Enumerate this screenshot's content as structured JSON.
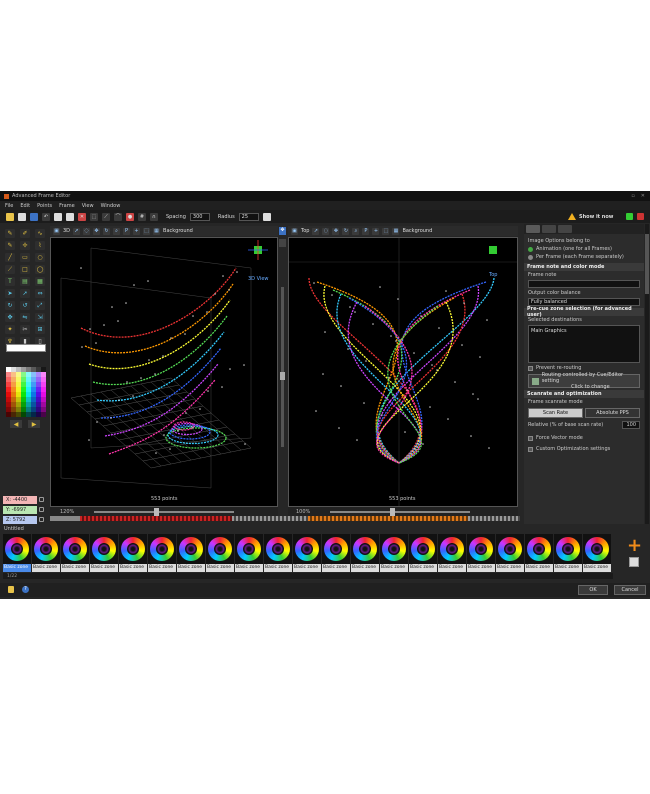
{
  "window": {
    "title": "Advanced Frame Editor"
  },
  "menu": [
    "File",
    "Edit",
    "Points",
    "Frame",
    "View",
    "Window"
  ],
  "toolbar": {
    "spacing_label": "Spacing",
    "spacing_value": "300",
    "radius_label": "Radius",
    "radius_value": "25",
    "show_label": "Show it now"
  },
  "coords": {
    "x": "X: -4400",
    "y": "Y: -6997",
    "z": "Z: 5792"
  },
  "viewport_left": {
    "mode": "3D",
    "background_label": "Background",
    "view_tag": "3D View",
    "points": "553 points",
    "zoom": "120%"
  },
  "viewport_right": {
    "mode": "Top",
    "background_label": "Background",
    "view_tag": "Top",
    "points": "553 points",
    "zoom": "100%"
  },
  "panel": {
    "options_title": "Image Options belong to",
    "opt_animation": "Animation (one for all Frames)",
    "opt_perframe": "Per Frame (each Frame separately)",
    "sec_note": "Frame note and color mode",
    "frame_note_label": "Frame note",
    "output_color_label": "Output color balance",
    "output_color_value": "Fully balanced",
    "sec_zone": "Pre-cue zone selection (for advanced user)",
    "dest_label": "Selected destinations",
    "dest_value": "Main Graphics",
    "prevent": "Prevent re-routing",
    "routing_btn1": "Routing controlled by Cue/Editor setting",
    "routing_btn2": "Click to change",
    "sec_scan": "Scanrate and optimization",
    "scan_mode_label": "Frame scanrate mode",
    "scan_rate": "Scan Rate",
    "abs_pps": "Absolute PPS",
    "relative_label": "Relative (% of base scan rate)",
    "relative_value": "100",
    "force_vector": "Force Vector mode",
    "custom_opt": "Custom Optimization settings"
  },
  "timeline": {
    "label": "Untitled",
    "thumb_label": "Basic zone",
    "thumbs": [
      "Basic zone",
      "Basic zone",
      "Basic zone",
      "Basic zone",
      "Basic zone",
      "Basic zone",
      "Basic zone",
      "Basic zone",
      "Basic zone",
      "Basic zone",
      "Basic zone",
      "Basic zone",
      "Basic zone",
      "Basic zone",
      "Basic zone",
      "Basic zone",
      "Basic zone",
      "Basic zone",
      "Basic zone",
      "Basic zone",
      "Basic zone"
    ],
    "scroll_label": "1/22"
  },
  "footer": {
    "ok": "OK",
    "cancel": "Cancel"
  },
  "colors": {
    "accent_orange": "#f28c1a",
    "selected_blue": "#4a8ae8"
  }
}
